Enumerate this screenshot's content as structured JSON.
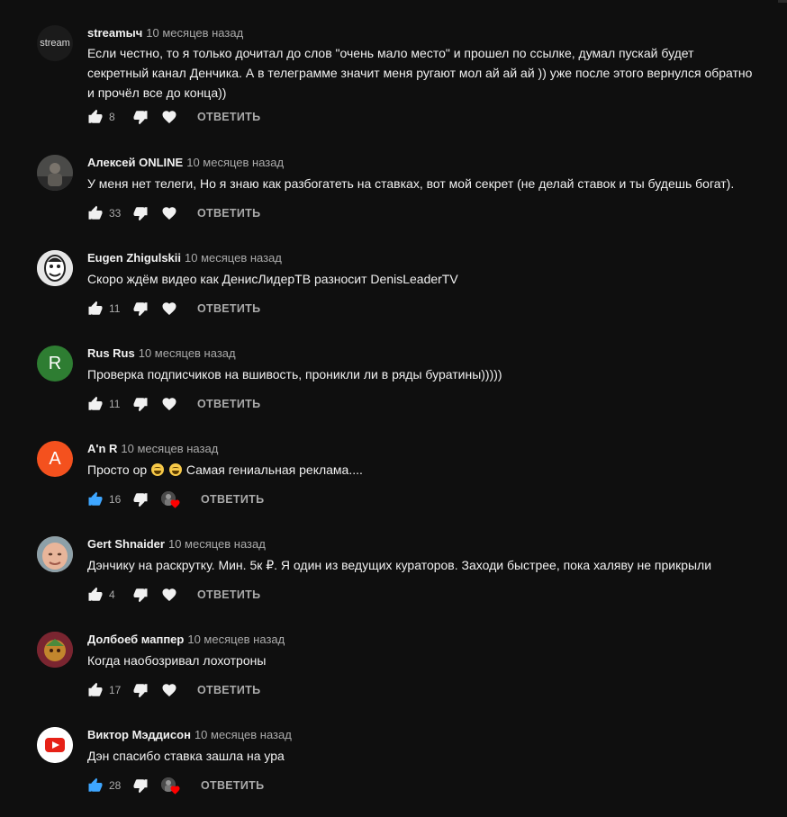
{
  "reply_label": "ОТВЕТИТЬ",
  "colors": {
    "background": "#0f0f0f",
    "text": "#f1f1f1",
    "muted": "#aaaaaa",
    "like_active": "#3ea6ff",
    "heart_red": "#ff0000"
  },
  "comments": [
    {
      "author": "streamыч",
      "time": "10 месяцев назад",
      "avatar_text": "stream",
      "text": "Если честно, то я только дочитал до слов \"очень мало место\" и прошел по ссылке, думал пускай будет секретный канал Денчика. А в телеграмме значит меня ругают мол ай ай ай )) уже после этого вернулся обратно и прочёл все до конца))",
      "likes": "8",
      "liked": false,
      "creator_hearted": false
    },
    {
      "author": "Алексей ONLINE",
      "time": "10 месяцев назад",
      "avatar_text": "",
      "text": "У меня нет телеги, Но я знаю как разбогатеть на ставках, вот мой секрет (не делай ставок и ты будешь богат).",
      "likes": "33",
      "liked": false,
      "creator_hearted": false
    },
    {
      "author": "Eugen Zhigulskii",
      "time": "10 месяцев назад",
      "avatar_text": "",
      "text": "Скоро ждём видео как ДенисЛидерТВ разносит DenisLeaderTV",
      "likes": "11",
      "liked": false,
      "creator_hearted": false
    },
    {
      "author": "Rus Rus",
      "time": "10 месяцев назад",
      "avatar_text": "R",
      "avatar_color": "#2e7d32",
      "text": "Проверка подписчиков на вшивость, проникли ли в ряды буратины)))))",
      "likes": "11",
      "liked": false,
      "creator_hearted": false
    },
    {
      "author": "A'n R",
      "time": "10 месяцев назад",
      "avatar_text": "A",
      "avatar_color": "#f4511e",
      "text_before": "Просто ор",
      "text_after": "Самая гениальная реклама....",
      "likes": "16",
      "liked": true,
      "creator_hearted": true
    },
    {
      "author": "Gert Shnaider",
      "time": "10 месяцев назад",
      "avatar_text": "",
      "text": "Дэнчику на раскрутку. Мин. 5к ₽. Я один из ведущих кураторов. Заходи быстрее, пока халяву не прикрыли",
      "likes": "4",
      "liked": false,
      "creator_hearted": false
    },
    {
      "author": "Долбоеб маппер",
      "time": "10 месяцев назад",
      "avatar_text": "",
      "text": "Когда наобозривал лохотроны",
      "likes": "17",
      "liked": false,
      "creator_hearted": false
    },
    {
      "author": "Виктор Мэддисон",
      "time": "10 месяцев назад",
      "avatar_text": "",
      "text": "Дэн спасибо ставка зашла на ура",
      "likes": "28",
      "liked": true,
      "creator_hearted": true
    }
  ]
}
